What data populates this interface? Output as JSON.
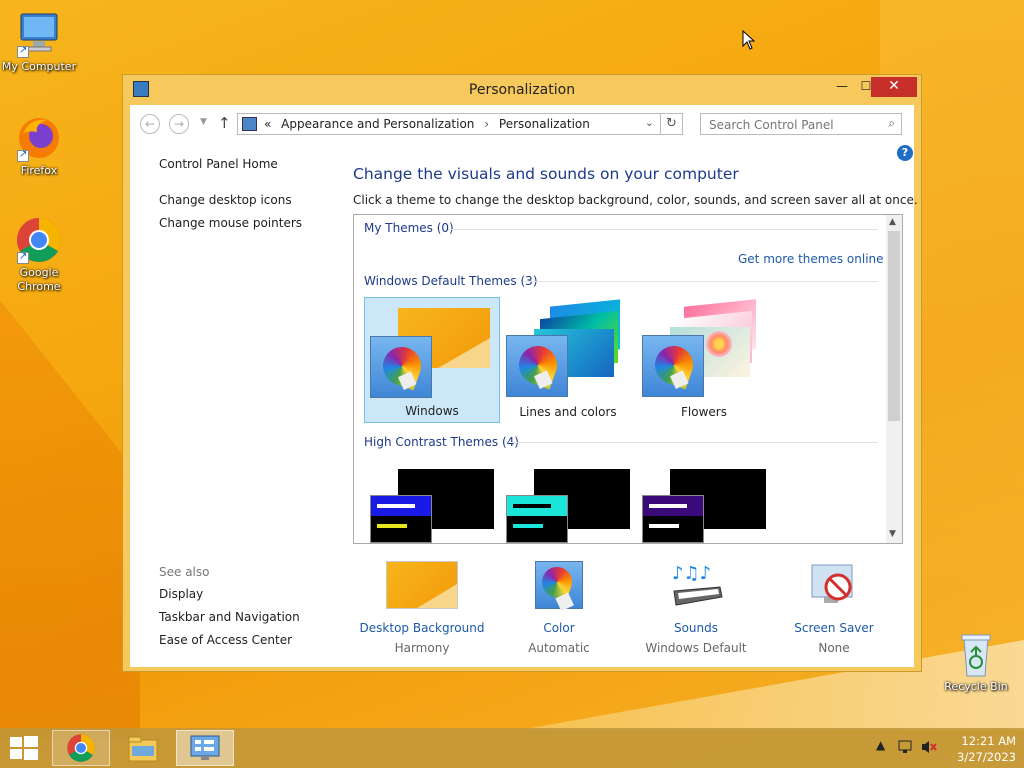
{
  "desktop": {
    "icons": [
      {
        "label": "My Computer"
      },
      {
        "label": "Firefox"
      },
      {
        "label": "Google Chrome"
      },
      {
        "label": "Recycle Bin"
      }
    ]
  },
  "window": {
    "title": "Personalization",
    "controls": {
      "minimize": "—",
      "maximize": "☐",
      "close": "✕"
    }
  },
  "addressbar": {
    "chevron": "«",
    "crumbs": [
      "Appearance and Personalization",
      "Personalization"
    ],
    "separator": "›",
    "search_placeholder": "Search Control Panel"
  },
  "left_pane": {
    "home": "Control Panel Home",
    "links": [
      "Change desktop icons",
      "Change mouse pointers"
    ],
    "see_also_title": "See also",
    "see_also": [
      "Display",
      "Taskbar and Navigation",
      "Ease of Access Center"
    ]
  },
  "main": {
    "heading": "Change the visuals and sounds on your computer",
    "subtext": "Click a theme to change the desktop background, color, sounds, and screen saver all at once.",
    "groups": {
      "my_themes": "My Themes (0)",
      "more_link": "Get more themes online",
      "default_title": "Windows Default Themes (3)",
      "high_contrast_title": "High Contrast Themes (4)"
    },
    "default_themes": [
      {
        "name": "Windows",
        "selected": true
      },
      {
        "name": "Lines and colors",
        "selected": false
      },
      {
        "name": "Flowers",
        "selected": false
      }
    ],
    "high_contrast_colors": [
      "#1a1ae6",
      "#19e6d8",
      "#3a0a7a"
    ]
  },
  "bottom": [
    {
      "label": "Desktop Background",
      "value": "Harmony"
    },
    {
      "label": "Color",
      "value": "Automatic"
    },
    {
      "label": "Sounds",
      "value": "Windows Default"
    },
    {
      "label": "Screen Saver",
      "value": "None"
    }
  ],
  "taskbar": {
    "time": "12:21 AM",
    "date": "3/27/2023"
  },
  "colors": {
    "accent_link": "#1e5aa8",
    "heading": "#1e3a8a",
    "close": "#c7302a",
    "frame": "#f7c85c"
  }
}
